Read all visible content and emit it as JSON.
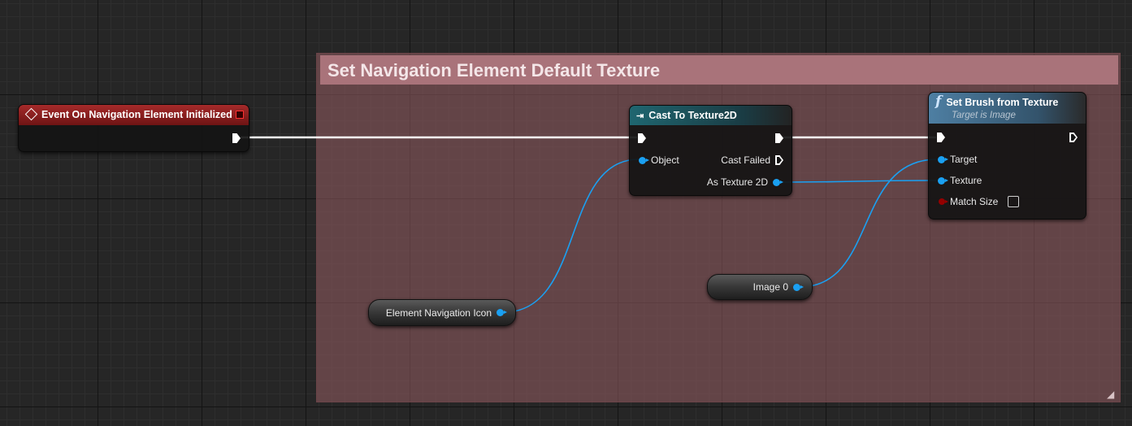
{
  "comment": {
    "title": "Set Navigation Element Default Texture"
  },
  "nodes": {
    "event": {
      "title": "Event On Navigation Element Initialized",
      "icon": "event-diamond-icon",
      "header_color": "#8c1f1f"
    },
    "cast": {
      "title": "Cast To Texture2D",
      "icon": "cast-arrow-icon",
      "header_color": "#1e5b63",
      "pins": {
        "object": "Object",
        "cast_failed": "Cast Failed",
        "as_texture": "As Texture 2D"
      }
    },
    "set_brush": {
      "title": "Set Brush from Texture",
      "subtitle": "Target is Image",
      "icon": "function-f-icon",
      "header_color": "#3e6b8c",
      "pins": {
        "target": "Target",
        "texture": "Texture",
        "match_size": "Match Size"
      }
    },
    "var_icon": {
      "label": "Element Navigation Icon"
    },
    "var_image": {
      "label": "Image 0"
    }
  },
  "colors": {
    "exec_wire": "#ffffff",
    "object_wire": "#1aa0f2",
    "bool_pin": "#950000",
    "comment_header": "#a9737a"
  }
}
